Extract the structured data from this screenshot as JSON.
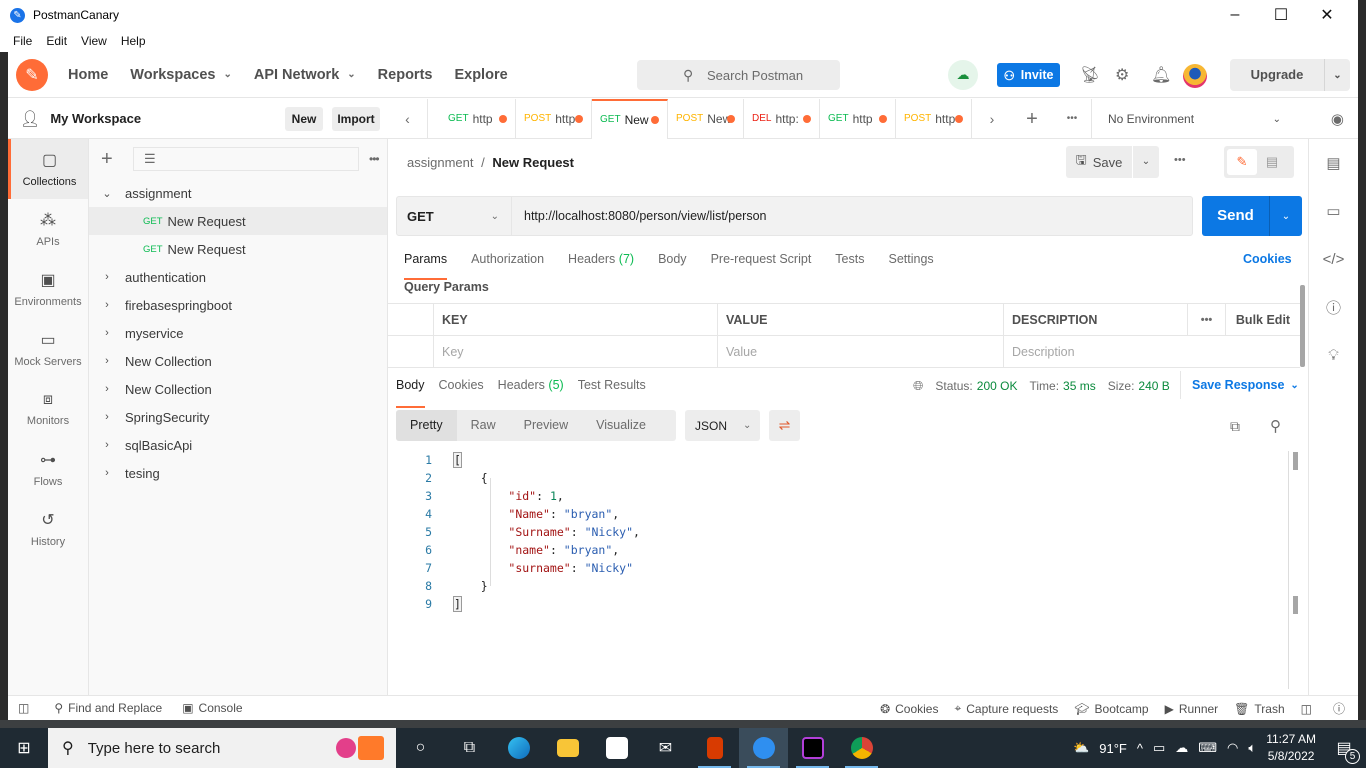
{
  "window": {
    "title": "PostmanCanary",
    "controls": {
      "minimize": "–",
      "maximize": "☐",
      "close": "✕"
    }
  },
  "menu": [
    "File",
    "Edit",
    "View",
    "Help"
  ],
  "topnav": {
    "items": [
      {
        "label": "Home",
        "dropdown": false
      },
      {
        "label": "Workspaces",
        "dropdown": true
      },
      {
        "label": "API Network",
        "dropdown": true
      },
      {
        "label": "Reports",
        "dropdown": false
      },
      {
        "label": "Explore",
        "dropdown": false
      }
    ],
    "search_placeholder": "Search Postman",
    "invite_label": "Invite",
    "upgrade_label": "Upgrade"
  },
  "workspace": {
    "name": "My Workspace",
    "new_label": "New",
    "import_label": "Import"
  },
  "rail": [
    {
      "label": "Collections",
      "icon": "collections-icon",
      "active": true
    },
    {
      "label": "APIs",
      "icon": "apis-icon",
      "active": false
    },
    {
      "label": "Environments",
      "icon": "environments-icon",
      "active": false
    },
    {
      "label": "Mock Servers",
      "icon": "mock-servers-icon",
      "active": false
    },
    {
      "label": "Monitors",
      "icon": "monitors-icon",
      "active": false
    },
    {
      "label": "Flows",
      "icon": "flows-icon",
      "active": false
    },
    {
      "label": "History",
      "icon": "history-icon",
      "active": false
    }
  ],
  "collections": [
    {
      "name": "assignment",
      "expanded": true,
      "requests": [
        {
          "method": "GET",
          "name": "New Request",
          "selected": true
        },
        {
          "method": "GET",
          "name": "New Request",
          "selected": false
        }
      ]
    },
    {
      "name": "authentication",
      "expanded": false
    },
    {
      "name": "firebasespringboot",
      "expanded": false
    },
    {
      "name": "myservice",
      "expanded": false
    },
    {
      "name": "New Collection",
      "expanded": false
    },
    {
      "name": "New Collection",
      "expanded": false
    },
    {
      "name": "SpringSecurity",
      "expanded": false
    },
    {
      "name": "sqlBasicApi",
      "expanded": false
    },
    {
      "name": "tesing",
      "expanded": false
    }
  ],
  "tabs": [
    {
      "method": "GET",
      "label": "http",
      "color": "#0cbb52",
      "active": false
    },
    {
      "method": "POST",
      "label": "http",
      "color": "#ffb400",
      "active": false
    },
    {
      "method": "GET",
      "label": "New",
      "color": "#0cbb52",
      "active": true
    },
    {
      "method": "POST",
      "label": "New",
      "color": "#ffb400",
      "active": false
    },
    {
      "method": "DEL",
      "label": "http:",
      "color": "#eb2013",
      "active": false
    },
    {
      "method": "GET",
      "label": "http",
      "color": "#0cbb52",
      "active": false
    },
    {
      "method": "POST",
      "label": "http",
      "color": "#ffb400",
      "active": false
    }
  ],
  "environment": {
    "selected": "No Environment"
  },
  "request": {
    "breadcrumb": {
      "collection": "assignment",
      "separator": "/",
      "name": "New Request"
    },
    "save_label": "Save",
    "method": "GET",
    "url": "http://localhost:8080/person/view/list/person",
    "send_label": "Send",
    "tabs": [
      {
        "label": "Params",
        "count": null,
        "active": true
      },
      {
        "label": "Authorization",
        "count": null,
        "active": false
      },
      {
        "label": "Headers",
        "count": "(7)",
        "active": false
      },
      {
        "label": "Body",
        "count": null,
        "active": false
      },
      {
        "label": "Pre-request Script",
        "count": null,
        "active": false
      },
      {
        "label": "Tests",
        "count": null,
        "active": false
      },
      {
        "label": "Settings",
        "count": null,
        "active": false
      }
    ],
    "cookies_link": "Cookies",
    "query_params_title": "Query Params",
    "params_table": {
      "headers": [
        "KEY",
        "VALUE",
        "DESCRIPTION"
      ],
      "bulk_edit": "Bulk Edit",
      "placeholders": [
        "Key",
        "Value",
        "Description"
      ]
    }
  },
  "response": {
    "tabs": [
      {
        "label": "Body",
        "count": null,
        "active": true
      },
      {
        "label": "Cookies",
        "count": null,
        "active": false
      },
      {
        "label": "Headers",
        "count": "(5)",
        "active": false
      },
      {
        "label": "Test Results",
        "count": null,
        "active": false
      }
    ],
    "status_label": "Status:",
    "status": "200 OK",
    "time_label": "Time:",
    "time": "35 ms",
    "size_label": "Size:",
    "size": "240 B",
    "save_response": "Save Response",
    "view_modes": [
      {
        "label": "Pretty",
        "active": true
      },
      {
        "label": "Raw",
        "active": false
      },
      {
        "label": "Preview",
        "active": false
      },
      {
        "label": "Visualize",
        "active": false
      }
    ],
    "format": "JSON",
    "body_lines": [
      {
        "n": 1,
        "indent": 0,
        "tokens": [
          {
            "t": "[",
            "c": "bracket"
          }
        ]
      },
      {
        "n": 2,
        "indent": 1,
        "tokens": [
          {
            "t": "{",
            "c": "p"
          }
        ]
      },
      {
        "n": 3,
        "indent": 2,
        "tokens": [
          {
            "t": "\"id\"",
            "c": "k"
          },
          {
            "t": ": ",
            "c": "p"
          },
          {
            "t": "1",
            "c": "n"
          },
          {
            "t": ",",
            "c": "p"
          }
        ]
      },
      {
        "n": 4,
        "indent": 2,
        "tokens": [
          {
            "t": "\"Name\"",
            "c": "k"
          },
          {
            "t": ": ",
            "c": "p"
          },
          {
            "t": "\"bryan\"",
            "c": "s"
          },
          {
            "t": ",",
            "c": "p"
          }
        ]
      },
      {
        "n": 5,
        "indent": 2,
        "tokens": [
          {
            "t": "\"Surname\"",
            "c": "k"
          },
          {
            "t": ": ",
            "c": "p"
          },
          {
            "t": "\"Nicky\"",
            "c": "s"
          },
          {
            "t": ",",
            "c": "p"
          }
        ]
      },
      {
        "n": 6,
        "indent": 2,
        "tokens": [
          {
            "t": "\"name\"",
            "c": "k"
          },
          {
            "t": ": ",
            "c": "p"
          },
          {
            "t": "\"bryan\"",
            "c": "s"
          },
          {
            "t": ",",
            "c": "p"
          }
        ]
      },
      {
        "n": 7,
        "indent": 2,
        "tokens": [
          {
            "t": "\"surname\"",
            "c": "k"
          },
          {
            "t": ": ",
            "c": "p"
          },
          {
            "t": "\"Nicky\"",
            "c": "s"
          }
        ]
      },
      {
        "n": 8,
        "indent": 1,
        "tokens": [
          {
            "t": "}",
            "c": "p"
          }
        ]
      },
      {
        "n": 9,
        "indent": 0,
        "tokens": [
          {
            "t": "]",
            "c": "bracket"
          }
        ]
      }
    ]
  },
  "footer": {
    "left": [
      {
        "label": "",
        "icon": "sidebar-toggle-icon"
      },
      {
        "label": "Find and Replace",
        "icon": "search-icon"
      },
      {
        "label": "Console",
        "icon": "console-icon"
      }
    ],
    "right": [
      {
        "label": "Cookies",
        "icon": "cookie-icon"
      },
      {
        "label": "Capture requests",
        "icon": "satellite-icon"
      },
      {
        "label": "Bootcamp",
        "icon": "bootcamp-icon"
      },
      {
        "label": "Runner",
        "icon": "runner-icon"
      },
      {
        "label": "Trash",
        "icon": "trash-icon"
      },
      {
        "label": "",
        "icon": "two-pane-icon"
      },
      {
        "label": "",
        "icon": "help-icon"
      }
    ]
  },
  "taskbar": {
    "search_placeholder": "Type here to search",
    "weather": "91°F",
    "time": "11:27 AM",
    "date": "5/8/2022",
    "notifications": "5"
  },
  "colors": {
    "accent": "#ff6c37",
    "primary": "#0c78e4",
    "success": "#0a8a3c"
  }
}
